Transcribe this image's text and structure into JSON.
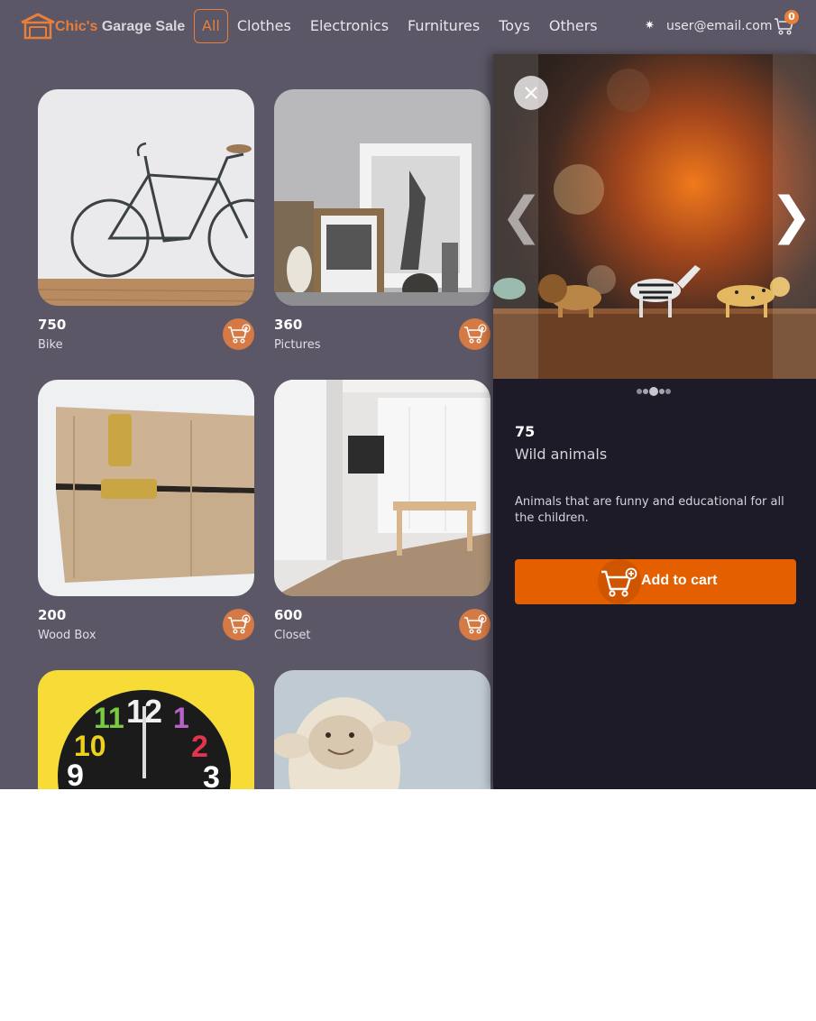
{
  "header": {
    "brand_accent": "Chic's",
    "brand_rest": "Garage Sale",
    "nav": [
      "All",
      "Clothes",
      "Electronics",
      "Furnitures",
      "Toys",
      "Others"
    ],
    "active_nav": "All",
    "theme_icon": "sun-icon",
    "user_email": "user@email.com",
    "cart_count": "0"
  },
  "products": [
    {
      "price": "750",
      "name": "Bike"
    },
    {
      "price": "360",
      "name": "Pictures"
    },
    {
      "price": "200",
      "name": "Wood Box"
    },
    {
      "price": "600",
      "name": "Closet"
    },
    {
      "price": "",
      "name": ""
    },
    {
      "price": "",
      "name": ""
    }
  ],
  "detail": {
    "price": "75",
    "name": "Wild animals",
    "description": "Animals that are funny and educational for all the children.",
    "add_to_cart_label": "Add to cart",
    "carousel_slides": 5,
    "carousel_active_slide": 3
  },
  "colors": {
    "accent": "#e77f3a",
    "button": "#e35f00",
    "page_overlay": "#5b5766",
    "panel": "#1d1b28"
  }
}
